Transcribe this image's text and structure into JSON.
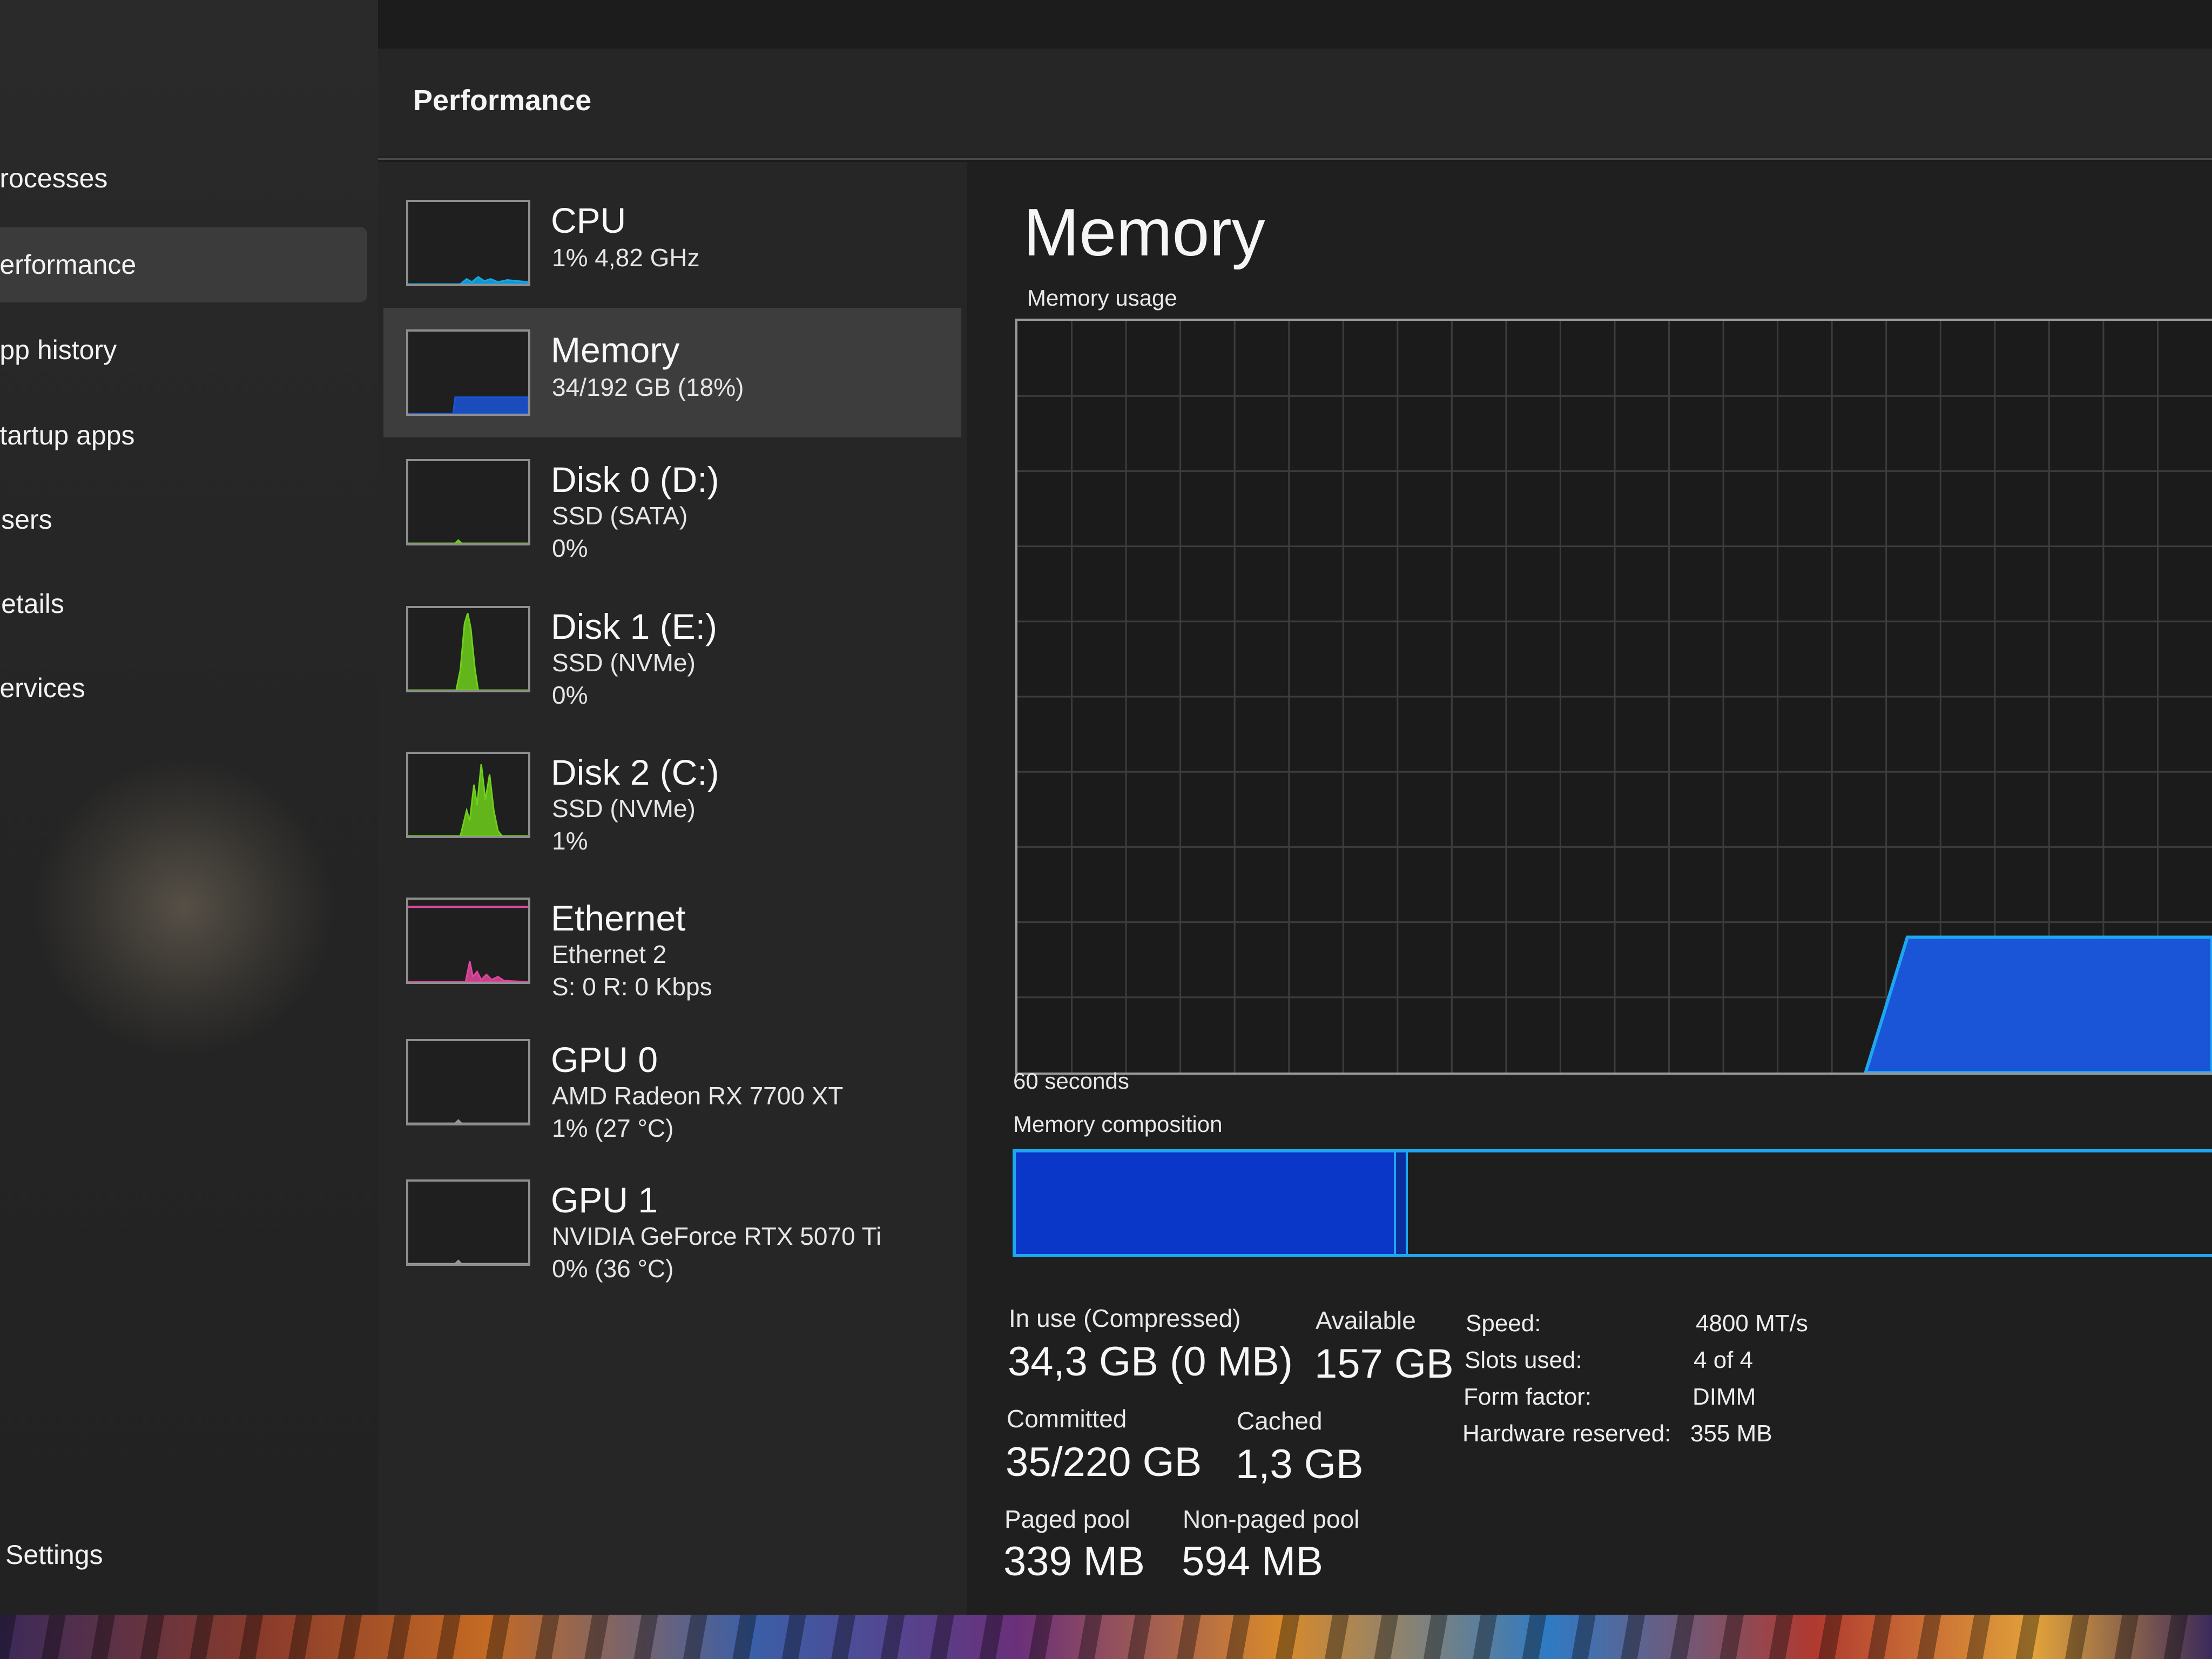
{
  "nav": {
    "items": [
      {
        "label": "Processes",
        "active": false
      },
      {
        "label": "Performance",
        "active": true
      },
      {
        "label": "App history",
        "active": false
      },
      {
        "label": "Startup apps",
        "active": false
      },
      {
        "label": "Users",
        "active": false
      },
      {
        "label": "Details",
        "active": false
      },
      {
        "label": "Services",
        "active": false
      }
    ],
    "settings_label": "Settings"
  },
  "header": {
    "title": "Performance"
  },
  "devices": [
    {
      "name": "CPU",
      "lines": [
        "1% 4,82 GHz"
      ],
      "active": false,
      "graph": "cpu",
      "color": "#17a8e6"
    },
    {
      "name": "Memory",
      "lines": [
        "34/192 GB (18%)"
      ],
      "active": true,
      "graph": "memory",
      "color": "#1a55d8"
    },
    {
      "name": "Disk 0 (D:)",
      "lines": [
        "SSD (SATA)",
        "0%"
      ],
      "active": false,
      "graph": "flat",
      "color": "#6fd01a"
    },
    {
      "name": "Disk 1 (E:)",
      "lines": [
        "SSD (NVMe)",
        "0%"
      ],
      "active": false,
      "graph": "disk1",
      "color": "#6fd01a"
    },
    {
      "name": "Disk 2 (C:)",
      "lines": [
        "SSD (NVMe)",
        "1%"
      ],
      "active": false,
      "graph": "disk2",
      "color": "#6fd01a"
    },
    {
      "name": "Ethernet",
      "lines": [
        "Ethernet 2",
        "S: 0 R: 0 Kbps"
      ],
      "active": false,
      "graph": "ethernet",
      "color": "#e0479e"
    },
    {
      "name": "GPU 0",
      "lines": [
        "AMD Radeon RX 7700 XT",
        "1% (27 °C)"
      ],
      "active": false,
      "graph": "flat",
      "color": "#9a9a9a"
    },
    {
      "name": "GPU 1",
      "lines": [
        "NVIDIA GeForce RTX 5070 Ti",
        "0% (36 °C)"
      ],
      "active": false,
      "graph": "flat",
      "color": "#9a9a9a"
    }
  ],
  "main": {
    "title": "Memory",
    "usage_label": "Memory usage",
    "time_label": "60 seconds",
    "composition_label": "Memory composition",
    "usage_fill_fraction": 0.18,
    "stats": {
      "in_use_label": "In use (Compressed)",
      "in_use_value": "34,3 GB (0 MB)",
      "available_label": "Available",
      "available_value": "157 GB",
      "committed_label": "Committed",
      "committed_value": "35/220 GB",
      "cached_label": "Cached",
      "cached_value": "1,3 GB",
      "paged_label": "Paged pool",
      "paged_value": "339 MB",
      "nonpaged_label": "Non-paged pool",
      "nonpaged_value": "594 MB"
    },
    "specs": [
      {
        "key": "Speed:",
        "value": "4800 MT/s"
      },
      {
        "key": "Slots used:",
        "value": "4 of 4"
      },
      {
        "key": "Form factor:",
        "value": "DIMM"
      },
      {
        "key": "Hardware reserved:",
        "value": "355 MB"
      }
    ]
  },
  "colors": {
    "accent_memory": "#1a55d8",
    "accent_memory_border": "#1ea7f0",
    "disk_green": "#6fd01a",
    "ethernet_pink": "#e0479e"
  }
}
